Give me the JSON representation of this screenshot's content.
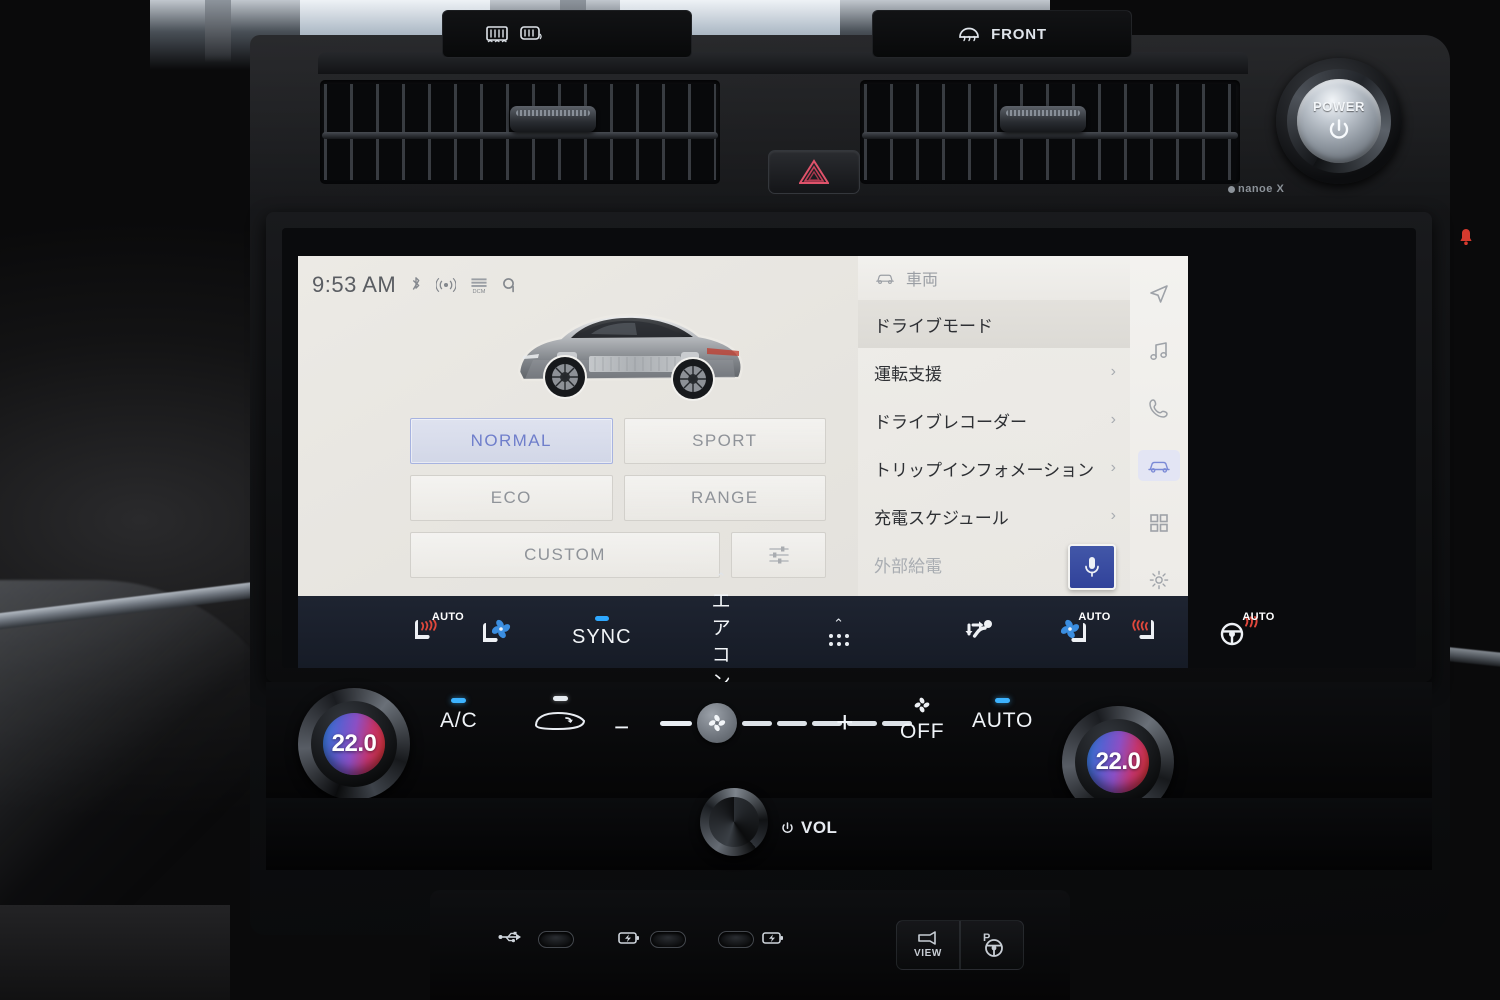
{
  "vehicle": {
    "brand_label": "nanoe X",
    "power_button": {
      "label": "POWER",
      "icon": "power-icon"
    },
    "hazard_button": {
      "icon": "hazard-triangle-icon"
    }
  },
  "screen": {
    "status_bar": {
      "time": "9:53 AM",
      "icons": [
        "bluetooth-icon",
        "wifi-signal-icon",
        "dcm-icon",
        "qi-charging-icon"
      ]
    },
    "hero": {
      "icon": "ev-vehicle-cutaway-image",
      "alt": "electric crossover x-ray view"
    },
    "drive_modes": {
      "rows": [
        [
          {
            "label": "NORMAL",
            "selected": true
          },
          {
            "label": "SPORT",
            "selected": false
          }
        ],
        [
          {
            "label": "ECO",
            "selected": false
          },
          {
            "label": "RANGE",
            "selected": false
          }
        ]
      ],
      "custom": {
        "label": "CUSTOM",
        "selected": false
      },
      "adjust_button": {
        "icon": "sliders-icon"
      },
      "selected_accent": "#6f7ecb"
    },
    "menu": {
      "header": {
        "label": "車両",
        "icon": "car-icon"
      },
      "items": [
        {
          "label": "ドライブモード",
          "active": true,
          "chevron": ""
        },
        {
          "label": "運転支援",
          "active": false,
          "chevron": "›"
        },
        {
          "label": "ドライブレコーダー",
          "active": false,
          "chevron": "›"
        },
        {
          "label": "トリップインフォメーション",
          "active": false,
          "chevron": "›"
        },
        {
          "label": "充電スケジュール",
          "active": false,
          "chevron": "›"
        },
        {
          "label": "外部給電",
          "active": false,
          "chevron": "",
          "dimmed": true
        }
      ]
    },
    "rail": {
      "items": [
        {
          "name": "navigation-icon",
          "active": false
        },
        {
          "name": "music-icon",
          "active": false
        },
        {
          "name": "phone-icon",
          "active": false
        },
        {
          "name": "car-icon",
          "active": true
        },
        {
          "name": "apps-grid-icon",
          "active": false
        },
        {
          "name": "settings-gear-icon",
          "active": false
        }
      ],
      "active_color": "#7b8ad6"
    },
    "mic_button": {
      "icon": "microphone-icon",
      "color": "#3a4da3"
    }
  },
  "hvac_bar": {
    "left": [
      {
        "name": "driver-seat-heater",
        "auto": "AUTO",
        "icon": "seat-heated-icon"
      },
      {
        "name": "driver-seat-ventilation",
        "icon": "seat-ventilated-icon"
      },
      {
        "name": "sync",
        "label": "SYNC",
        "led": true
      },
      {
        "name": "climate-menu",
        "label": "エアコン",
        "caret": "⌃"
      },
      {
        "name": "more-options",
        "icon": "grid-dots-icon",
        "caret": "⌃"
      }
    ],
    "right": [
      {
        "name": "airflow-mode",
        "icon": "airflow-person-icon"
      },
      {
        "name": "passenger-seat-ventilation",
        "icon": "seat-ventilated-icon",
        "auto": "AUTO"
      },
      {
        "name": "passenger-seat-heater",
        "icon": "seat-heated-icon"
      },
      {
        "name": "steering-wheel-heater",
        "icon": "steering-wheel-heated-icon",
        "auto": "AUTO"
      }
    ]
  },
  "climate_controls": {
    "temperature_left": {
      "value": "22.0",
      "name": "driver-temp-knob"
    },
    "temperature_right": {
      "value": "22.0",
      "name": "passenger-temp-knob"
    },
    "ac": {
      "label": "A/C",
      "led": "on",
      "led_color": "#3db3ff"
    },
    "recirculation": {
      "icon": "air-recirculation-icon",
      "led": "on",
      "led_color": "#e6ebf0"
    },
    "fan_decrease": {
      "label": "−"
    },
    "fan_increase": {
      "label": "+"
    },
    "fan_level": {
      "value": 2,
      "max": 7,
      "icon": "fan-icon"
    },
    "off": {
      "label": "OFF",
      "icon": "fan-icon"
    },
    "auto": {
      "label": "AUTO",
      "led": "on",
      "led_color": "#3db3ff"
    }
  },
  "bottom_row": {
    "defrost_rear": {
      "icon": "rear-defrost-icon"
    },
    "defrost_mirror": {
      "icon": "mirror-defrost-icon"
    },
    "volume": {
      "label": "VOL",
      "icon": "power-icon",
      "name": "volume-knob"
    },
    "front_defrost": {
      "label": "FRONT",
      "icon": "front-defrost-icon"
    }
  },
  "lower_console": {
    "ports": [
      {
        "name": "usb-data-port",
        "icon": "usb-icon"
      },
      {
        "name": "usb-c-charge-port-1",
        "icon": "battery-charge-icon"
      },
      {
        "name": "usb-c-charge-port-2",
        "icon": "battery-charge-icon"
      }
    ],
    "buttons": [
      {
        "name": "camera-view-button",
        "label": "VIEW",
        "icon": "camera-icon"
      },
      {
        "name": "park-assist-button",
        "label": "P",
        "icon": "steering-wheel-icon"
      }
    ]
  }
}
